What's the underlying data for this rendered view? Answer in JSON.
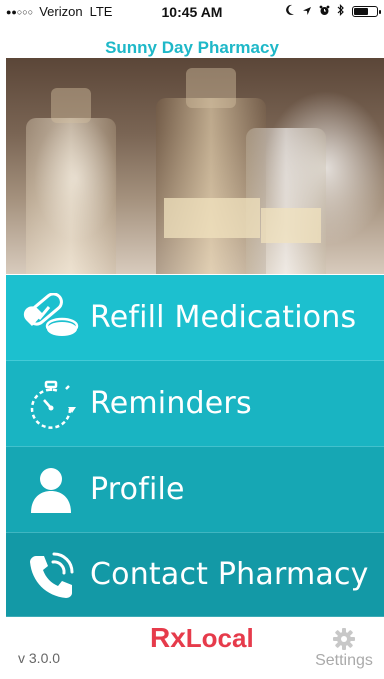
{
  "status_bar": {
    "signal_dots": "●●○○○",
    "carrier": "Verizon",
    "network": "LTE",
    "time": "10:45 AM",
    "icons": [
      "moon-icon",
      "location-arrow-icon",
      "alarm-icon",
      "bluetooth-icon",
      "battery-icon"
    ]
  },
  "header": {
    "title": "Sunny Day Pharmacy"
  },
  "hero": {
    "image_subject": "pharmacy bottles photo"
  },
  "menu": {
    "items": [
      {
        "label": "Refill Medications",
        "icon": "pill-icon"
      },
      {
        "label": "Reminders",
        "icon": "stopwatch-icon"
      },
      {
        "label": "Profile",
        "icon": "person-icon"
      },
      {
        "label": "Contact Pharmacy",
        "icon": "phone-icon"
      }
    ]
  },
  "footer": {
    "version": "v 3.0.0",
    "logo_rx": "Rx",
    "logo_text": "Local",
    "settings_label": "Settings"
  },
  "colors": {
    "accent": "#1fb8c8",
    "logo": "#e63b4b"
  }
}
